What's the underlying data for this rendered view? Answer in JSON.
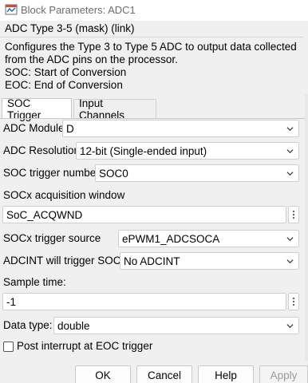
{
  "window": {
    "title": "Block Parameters: ADC1"
  },
  "mask": {
    "title": "ADC Type 3-5 (mask) (link)",
    "description": [
      "Configures the Type 3 to Type 5 ADC to output data collected",
      "from the ADC pins on the processor.",
      "SOC: Start of Conversion",
      "EOC: End of Conversion"
    ]
  },
  "tabs": [
    {
      "label": "SOC Trigger",
      "active": true
    },
    {
      "label": "Input Channels",
      "active": false
    }
  ],
  "fields": {
    "adc_module": {
      "label": "ADC Module",
      "value": "D"
    },
    "adc_resolution": {
      "label": "ADC Resolution",
      "value": "12-bit (Single-ended input)"
    },
    "soc_trigger_number": {
      "label": "SOC trigger number",
      "value": "SOC0"
    },
    "acq_window": {
      "label": "SOCx acquisition window",
      "value": "SoC_ACQWND"
    },
    "soc_trigger_source": {
      "label": "SOCx trigger source",
      "value": "ePWM1_ADCSOCA"
    },
    "adcint_trigger": {
      "label": "ADCINT will trigger SOCx",
      "value": "No ADCINT"
    },
    "sample_time": {
      "label": "Sample time:",
      "value": "-1"
    },
    "data_type": {
      "label": "Data type:",
      "value": "double"
    },
    "post_interrupt": {
      "label": "Post interrupt at EOC trigger",
      "checked": false
    }
  },
  "buttons": {
    "ok": "OK",
    "cancel": "Cancel",
    "help": "Help",
    "apply": "Apply"
  },
  "icons": {
    "app": "simulink-block-icon",
    "dropdown": "chevron-down-icon",
    "options": "more-vertical-icon"
  }
}
